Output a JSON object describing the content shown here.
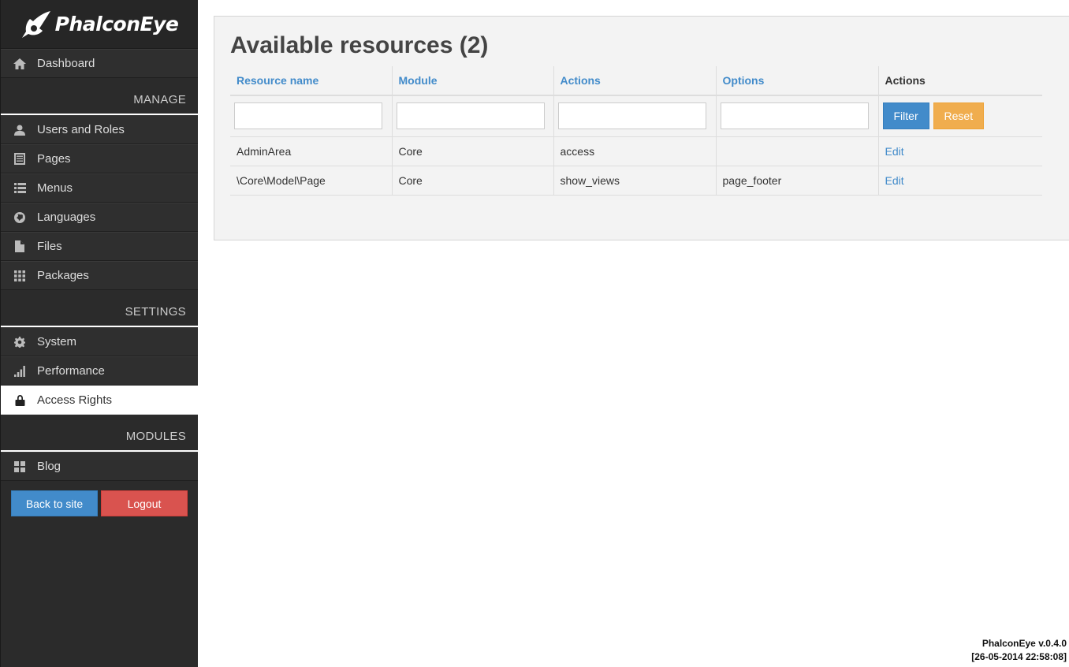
{
  "brand": {
    "name": "PhalconEye"
  },
  "sidebar": {
    "dashboard": {
      "label": "Dashboard",
      "icon": "home-icon"
    },
    "manage_header": "MANAGE",
    "manage_items": [
      {
        "label": "Users and Roles",
        "icon": "user-icon"
      },
      {
        "label": "Pages",
        "icon": "document-icon"
      },
      {
        "label": "Menus",
        "icon": "list-icon"
      },
      {
        "label": "Languages",
        "icon": "globe-icon"
      },
      {
        "label": "Files",
        "icon": "file-icon"
      },
      {
        "label": "Packages",
        "icon": "grid-icon"
      }
    ],
    "settings_header": "SETTINGS",
    "settings_items": [
      {
        "label": "System",
        "icon": "gear-icon"
      },
      {
        "label": "Performance",
        "icon": "signal-icon"
      },
      {
        "label": "Access Rights",
        "icon": "lock-icon",
        "active": true
      }
    ],
    "modules_header": "MODULES",
    "modules_items": [
      {
        "label": "Blog",
        "icon": "tiles-icon"
      }
    ],
    "back_button": "Back to site",
    "logout_button": "Logout"
  },
  "main": {
    "title": "Available resources (2)",
    "columns": [
      "Resource name",
      "Module",
      "Actions",
      "Options",
      "Actions"
    ],
    "filter_button": "Filter",
    "reset_button": "Reset",
    "rows": [
      {
        "resource": "AdminArea",
        "module": "Core",
        "actions": "access",
        "options": "",
        "edit": "Edit"
      },
      {
        "resource": "\\Core\\Model\\Page",
        "module": "Core",
        "actions": "show_views",
        "options": "page_footer",
        "edit": "Edit"
      }
    ]
  },
  "footer": {
    "version": "PhalconEye v.0.4.0",
    "timestamp": "[26-05-2014 22:58:08]"
  },
  "colors": {
    "sidebar_bg": "#2b2b2b",
    "accent_blue": "#428bca",
    "danger_red": "#d9534f",
    "warning_orange": "#f0ad4e"
  }
}
